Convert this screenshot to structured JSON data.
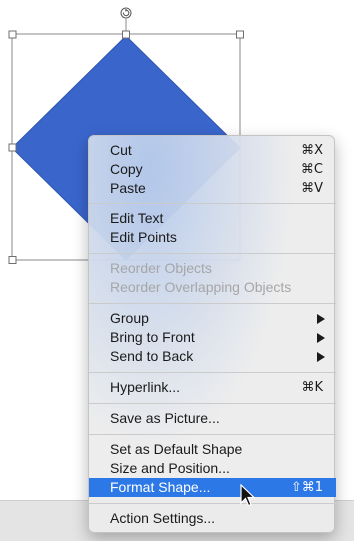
{
  "icons": {
    "rotate_handle": "rotate-icon",
    "submenu_arrow": "chevron-right-icon",
    "cursor": "mouse-pointer-icon"
  },
  "colors": {
    "shape_fill": "#3a66cc",
    "menu_highlight": "#2c78e6",
    "disabled_text": "#a6a6a6"
  },
  "context_menu": {
    "cut": {
      "label": "Cut",
      "shortcut": "⌘X"
    },
    "copy": {
      "label": "Copy",
      "shortcut": "⌘C"
    },
    "paste": {
      "label": "Paste",
      "shortcut": "⌘V"
    },
    "edit_text": {
      "label": "Edit Text"
    },
    "edit_points": {
      "label": "Edit Points"
    },
    "reorder_objects": {
      "label": "Reorder Objects",
      "enabled": false
    },
    "reorder_overlapping": {
      "label": "Reorder Overlapping Objects",
      "enabled": false
    },
    "group": {
      "label": "Group",
      "submenu": true
    },
    "bring_to_front": {
      "label": "Bring to Front",
      "submenu": true
    },
    "send_to_back": {
      "label": "Send to Back",
      "submenu": true
    },
    "hyperlink": {
      "label": "Hyperlink...",
      "shortcut": "⌘K"
    },
    "save_as_picture": {
      "label": "Save as Picture..."
    },
    "set_default_shape": {
      "label": "Set as Default Shape"
    },
    "size_and_position": {
      "label": "Size and Position..."
    },
    "format_shape": {
      "label": "Format Shape...",
      "shortcut": "⇧⌘1",
      "highlighted": true
    },
    "action_settings": {
      "label": "Action Settings..."
    }
  }
}
